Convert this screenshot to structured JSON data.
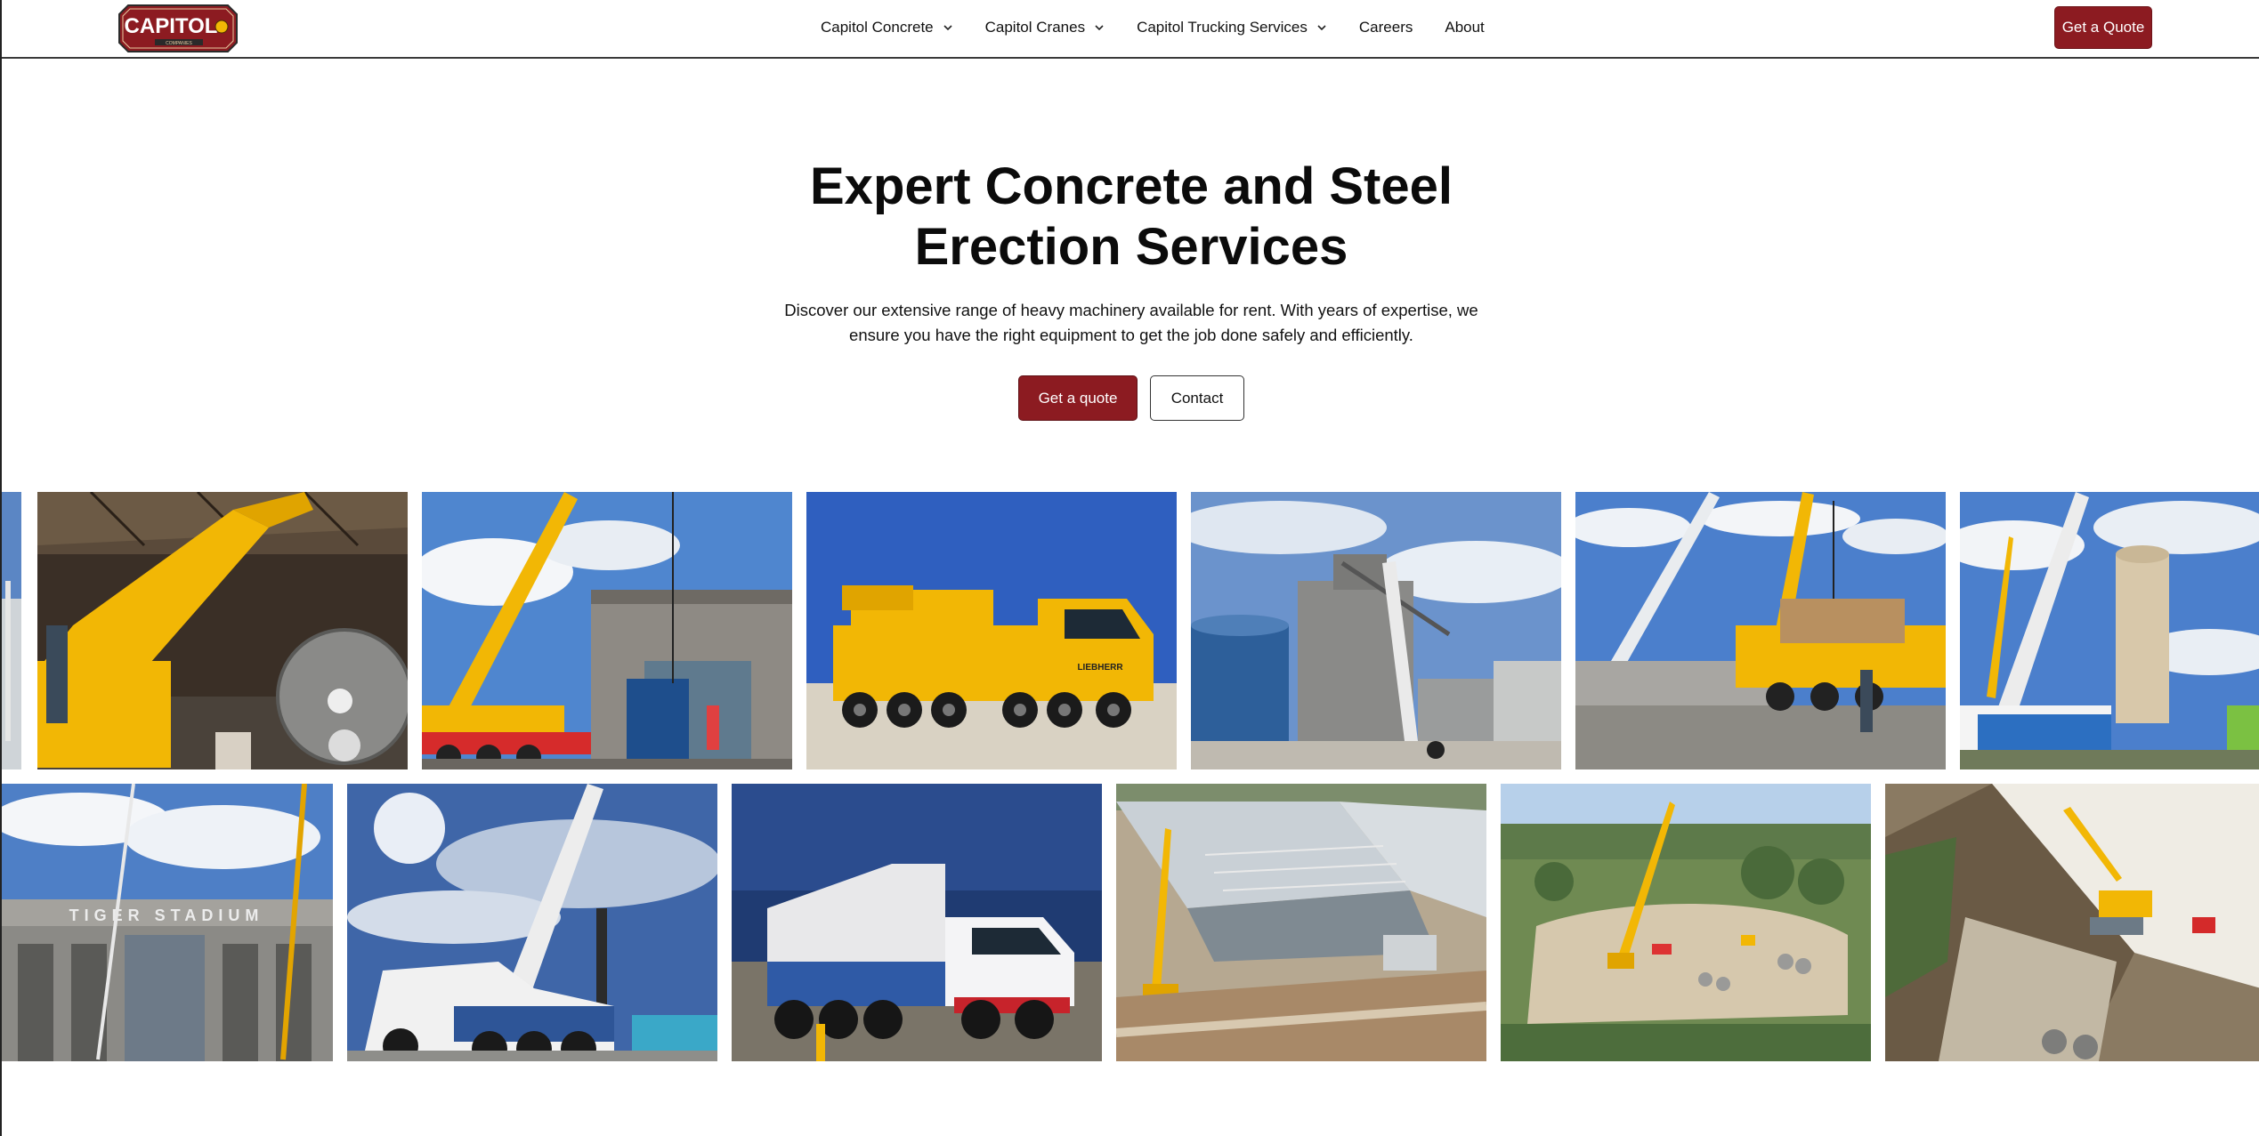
{
  "nav": {
    "logo_text": "CAPITOL",
    "logo_subtext": "COMPANIES",
    "items": [
      {
        "label": "Capitol Concrete",
        "has_dropdown": true
      },
      {
        "label": "Capitol Cranes",
        "has_dropdown": true
      },
      {
        "label": "Capitol Trucking Services",
        "has_dropdown": true
      },
      {
        "label": "Careers",
        "has_dropdown": false
      },
      {
        "label": "About",
        "has_dropdown": false
      }
    ],
    "cta_label": "Get a Quote"
  },
  "hero": {
    "title_line1": "Expert Concrete and Steel",
    "title_line2": "Erection Services",
    "description_line1": "Discover our extensive range of heavy machinery available for rent. With years of expertise, we",
    "description_line2": "ensure you have the right equipment to get the job done safely and efficiently.",
    "primary_button": "Get a quote",
    "secondary_button": "Contact"
  },
  "gallery": {
    "stadium_sign": "TIGER STADIUM",
    "truck_brand": "LIEBHERR"
  },
  "colors": {
    "brand_red": "#8c1b21",
    "sky_blue": "#4a7fc4",
    "crane_yellow": "#f2b705"
  }
}
